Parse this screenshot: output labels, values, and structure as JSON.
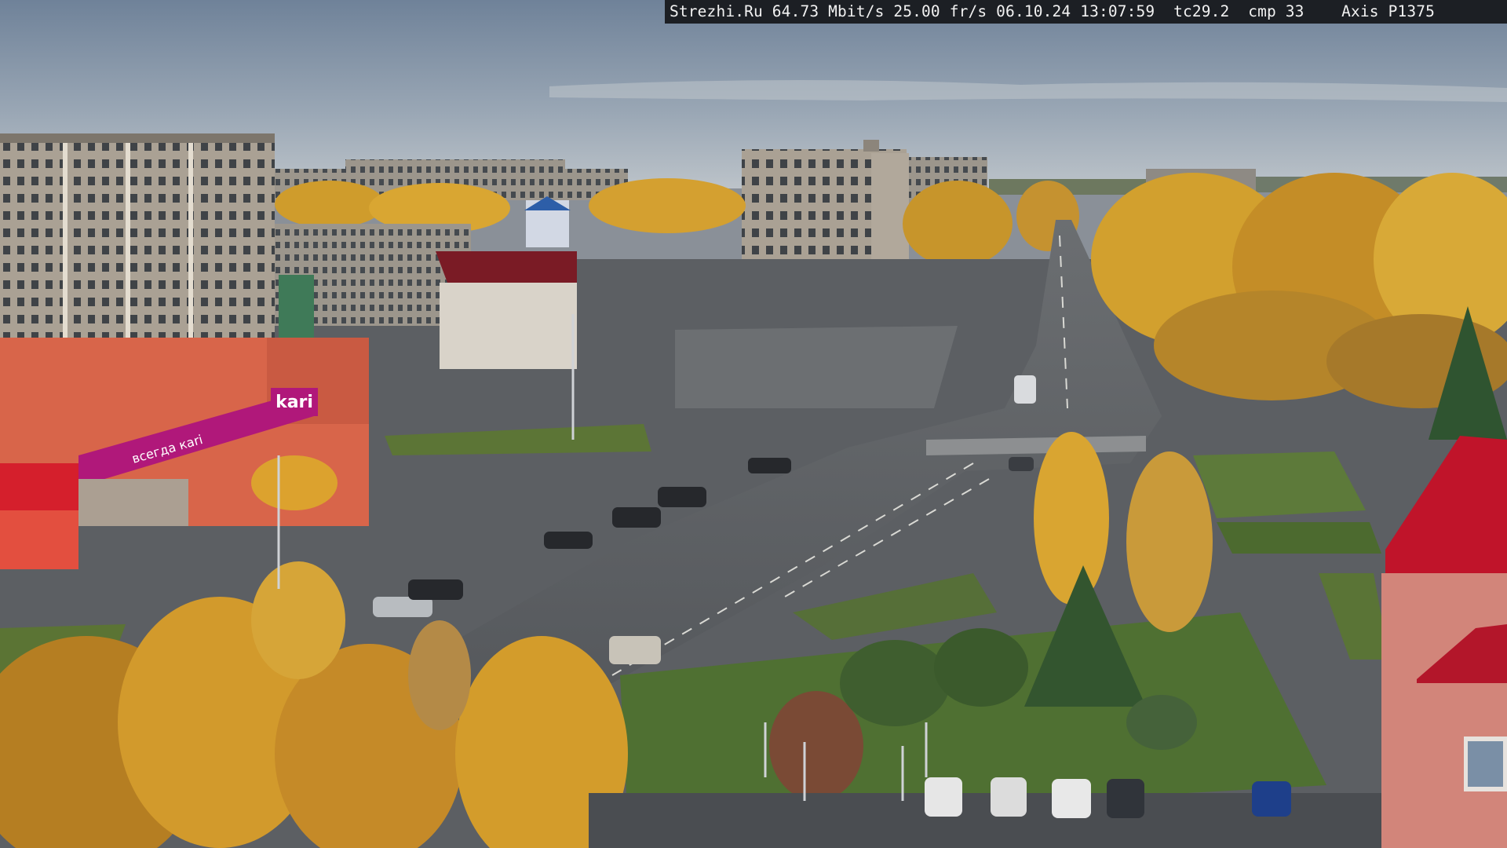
{
  "overlay": {
    "site": "Strezhi.Ru",
    "bitrate": "64.73 Mbit/s",
    "fps": "25.00 fr/s",
    "date": "06.10.24",
    "time": "13:07:59",
    "tc": "tc29.2",
    "cmp": "cmp 33",
    "camera": "Axis P1375"
  },
  "signage": {
    "store_logo": "kari",
    "store_banner": "всегда кari"
  },
  "colors": {
    "sky_top": "#7d8ea4",
    "sky_bottom": "#b6bec6",
    "asphalt": "#5e6165",
    "grass": "#4f6e32",
    "foliage": "#d6a12a",
    "foliage_dark": "#a9781e",
    "store_magenta": "#b0187a",
    "store_wall": "#d8654a",
    "red_roof": "#c0142a",
    "panel_building": "#a89f92"
  }
}
